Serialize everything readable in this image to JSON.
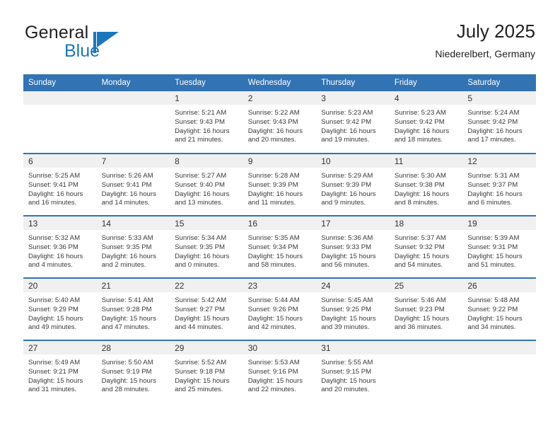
{
  "brand": {
    "name_part1": "General",
    "name_part2": "Blue",
    "mark": "blue-flag-triangle"
  },
  "header": {
    "title": "July 2025",
    "subtitle": "Niederelbert, Germany"
  },
  "theme": {
    "accent_blue": "#3273b4",
    "brand_blue": "#1b76bc",
    "daynum_band": "#f0f0f0",
    "text": "#333333"
  },
  "calendar": {
    "weekday_headers": [
      "Sunday",
      "Monday",
      "Tuesday",
      "Wednesday",
      "Thursday",
      "Friday",
      "Saturday"
    ],
    "weeks": [
      [
        {
          "day": "",
          "lines": [
            "",
            "",
            "",
            ""
          ],
          "empty": true
        },
        {
          "day": "",
          "lines": [
            "",
            "",
            "",
            ""
          ],
          "empty": true
        },
        {
          "day": "1",
          "lines": [
            "Sunrise: 5:21 AM",
            "Sunset: 9:43 PM",
            "Daylight: 16 hours",
            "and 21 minutes."
          ],
          "empty": false
        },
        {
          "day": "2",
          "lines": [
            "Sunrise: 5:22 AM",
            "Sunset: 9:43 PM",
            "Daylight: 16 hours",
            "and 20 minutes."
          ],
          "empty": false
        },
        {
          "day": "3",
          "lines": [
            "Sunrise: 5:23 AM",
            "Sunset: 9:42 PM",
            "Daylight: 16 hours",
            "and 19 minutes."
          ],
          "empty": false
        },
        {
          "day": "4",
          "lines": [
            "Sunrise: 5:23 AM",
            "Sunset: 9:42 PM",
            "Daylight: 16 hours",
            "and 18 minutes."
          ],
          "empty": false
        },
        {
          "day": "5",
          "lines": [
            "Sunrise: 5:24 AM",
            "Sunset: 9:42 PM",
            "Daylight: 16 hours",
            "and 17 minutes."
          ],
          "empty": false
        }
      ],
      [
        {
          "day": "6",
          "lines": [
            "Sunrise: 5:25 AM",
            "Sunset: 9:41 PM",
            "Daylight: 16 hours",
            "and 16 minutes."
          ],
          "empty": false
        },
        {
          "day": "7",
          "lines": [
            "Sunrise: 5:26 AM",
            "Sunset: 9:41 PM",
            "Daylight: 16 hours",
            "and 14 minutes."
          ],
          "empty": false
        },
        {
          "day": "8",
          "lines": [
            "Sunrise: 5:27 AM",
            "Sunset: 9:40 PM",
            "Daylight: 16 hours",
            "and 13 minutes."
          ],
          "empty": false
        },
        {
          "day": "9",
          "lines": [
            "Sunrise: 5:28 AM",
            "Sunset: 9:39 PM",
            "Daylight: 16 hours",
            "and 11 minutes."
          ],
          "empty": false
        },
        {
          "day": "10",
          "lines": [
            "Sunrise: 5:29 AM",
            "Sunset: 9:39 PM",
            "Daylight: 16 hours",
            "and 9 minutes."
          ],
          "empty": false
        },
        {
          "day": "11",
          "lines": [
            "Sunrise: 5:30 AM",
            "Sunset: 9:38 PM",
            "Daylight: 16 hours",
            "and 8 minutes."
          ],
          "empty": false
        },
        {
          "day": "12",
          "lines": [
            "Sunrise: 5:31 AM",
            "Sunset: 9:37 PM",
            "Daylight: 16 hours",
            "and 6 minutes."
          ],
          "empty": false
        }
      ],
      [
        {
          "day": "13",
          "lines": [
            "Sunrise: 5:32 AM",
            "Sunset: 9:36 PM",
            "Daylight: 16 hours",
            "and 4 minutes."
          ],
          "empty": false
        },
        {
          "day": "14",
          "lines": [
            "Sunrise: 5:33 AM",
            "Sunset: 9:35 PM",
            "Daylight: 16 hours",
            "and 2 minutes."
          ],
          "empty": false
        },
        {
          "day": "15",
          "lines": [
            "Sunrise: 5:34 AM",
            "Sunset: 9:35 PM",
            "Daylight: 16 hours",
            "and 0 minutes."
          ],
          "empty": false
        },
        {
          "day": "16",
          "lines": [
            "Sunrise: 5:35 AM",
            "Sunset: 9:34 PM",
            "Daylight: 15 hours",
            "and 58 minutes."
          ],
          "empty": false
        },
        {
          "day": "17",
          "lines": [
            "Sunrise: 5:36 AM",
            "Sunset: 9:33 PM",
            "Daylight: 15 hours",
            "and 56 minutes."
          ],
          "empty": false
        },
        {
          "day": "18",
          "lines": [
            "Sunrise: 5:37 AM",
            "Sunset: 9:32 PM",
            "Daylight: 15 hours",
            "and 54 minutes."
          ],
          "empty": false
        },
        {
          "day": "19",
          "lines": [
            "Sunrise: 5:39 AM",
            "Sunset: 9:31 PM",
            "Daylight: 15 hours",
            "and 51 minutes."
          ],
          "empty": false
        }
      ],
      [
        {
          "day": "20",
          "lines": [
            "Sunrise: 5:40 AM",
            "Sunset: 9:29 PM",
            "Daylight: 15 hours",
            "and 49 minutes."
          ],
          "empty": false
        },
        {
          "day": "21",
          "lines": [
            "Sunrise: 5:41 AM",
            "Sunset: 9:28 PM",
            "Daylight: 15 hours",
            "and 47 minutes."
          ],
          "empty": false
        },
        {
          "day": "22",
          "lines": [
            "Sunrise: 5:42 AM",
            "Sunset: 9:27 PM",
            "Daylight: 15 hours",
            "and 44 minutes."
          ],
          "empty": false
        },
        {
          "day": "23",
          "lines": [
            "Sunrise: 5:44 AM",
            "Sunset: 9:26 PM",
            "Daylight: 15 hours",
            "and 42 minutes."
          ],
          "empty": false
        },
        {
          "day": "24",
          "lines": [
            "Sunrise: 5:45 AM",
            "Sunset: 9:25 PM",
            "Daylight: 15 hours",
            "and 39 minutes."
          ],
          "empty": false
        },
        {
          "day": "25",
          "lines": [
            "Sunrise: 5:46 AM",
            "Sunset: 9:23 PM",
            "Daylight: 15 hours",
            "and 36 minutes."
          ],
          "empty": false
        },
        {
          "day": "26",
          "lines": [
            "Sunrise: 5:48 AM",
            "Sunset: 9:22 PM",
            "Daylight: 15 hours",
            "and 34 minutes."
          ],
          "empty": false
        }
      ],
      [
        {
          "day": "27",
          "lines": [
            "Sunrise: 5:49 AM",
            "Sunset: 9:21 PM",
            "Daylight: 15 hours",
            "and 31 minutes."
          ],
          "empty": false
        },
        {
          "day": "28",
          "lines": [
            "Sunrise: 5:50 AM",
            "Sunset: 9:19 PM",
            "Daylight: 15 hours",
            "and 28 minutes."
          ],
          "empty": false
        },
        {
          "day": "29",
          "lines": [
            "Sunrise: 5:52 AM",
            "Sunset: 9:18 PM",
            "Daylight: 15 hours",
            "and 25 minutes."
          ],
          "empty": false
        },
        {
          "day": "30",
          "lines": [
            "Sunrise: 5:53 AM",
            "Sunset: 9:16 PM",
            "Daylight: 15 hours",
            "and 22 minutes."
          ],
          "empty": false
        },
        {
          "day": "31",
          "lines": [
            "Sunrise: 5:55 AM",
            "Sunset: 9:15 PM",
            "Daylight: 15 hours",
            "and 20 minutes."
          ],
          "empty": false
        },
        {
          "day": "",
          "lines": [
            "",
            "",
            "",
            ""
          ],
          "empty": true
        },
        {
          "day": "",
          "lines": [
            "",
            "",
            "",
            ""
          ],
          "empty": true
        }
      ]
    ]
  }
}
